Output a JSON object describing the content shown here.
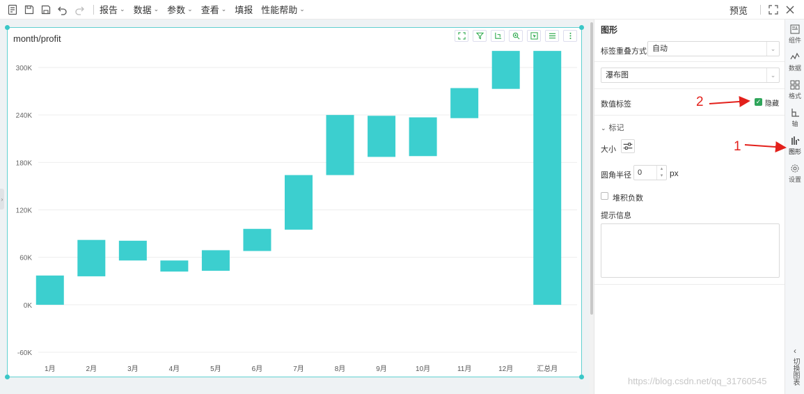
{
  "toolbar": {
    "menus": [
      "报告",
      "数据",
      "参数",
      "查看",
      "填报",
      "性能帮助"
    ],
    "preview_label": "预览"
  },
  "chart": {
    "title": "month/profit"
  },
  "chart_data": {
    "type": "bar",
    "subtype": "waterfall",
    "title": "month/profit",
    "categories": [
      "1月",
      "2月",
      "3月",
      "4月",
      "5月",
      "6月",
      "7月",
      "8月",
      "9月",
      "10月",
      "11月",
      "12月",
      "汇总月"
    ],
    "ranges": [
      [
        0,
        37000
      ],
      [
        36000,
        82000
      ],
      [
        56000,
        81000
      ],
      [
        42000,
        56000
      ],
      [
        43000,
        69000
      ],
      [
        68000,
        96000
      ],
      [
        95000,
        164000
      ],
      [
        164000,
        240000
      ],
      [
        187000,
        239000
      ],
      [
        188000,
        237000
      ],
      [
        236000,
        274000
      ],
      [
        273000,
        321000
      ],
      [
        0,
        321000
      ]
    ],
    "yticks": [
      "300K",
      "240K",
      "180K",
      "120K",
      "60K",
      "0K",
      "-60K"
    ],
    "ylim": [
      -60000,
      300000
    ],
    "color": "#3ccfcf",
    "grid": true
  },
  "panel": {
    "title": "图形",
    "overlap_label": "标签重叠方式",
    "overlap_value": "自动",
    "chart_type_value": "瀑布图",
    "data_label": "数值标签",
    "hide_label": "隐藏",
    "marker_label": "标记",
    "size_label": "大小",
    "radius_label": "圆角半径",
    "radius_value": "0",
    "radius_unit": "px",
    "stack_label": "堆积负数",
    "tooltip_label": "提示信息"
  },
  "sidebar": {
    "items": [
      {
        "label": "组件",
        "icon": "component-icon"
      },
      {
        "label": "数据",
        "icon": "data-icon"
      },
      {
        "label": "格式",
        "icon": "format-icon"
      },
      {
        "label": "轴",
        "icon": "axis-icon"
      },
      {
        "label": "图形",
        "icon": "shape-icon"
      },
      {
        "label": "设置",
        "icon": "settings-icon"
      }
    ],
    "switch_label": "切换图表"
  },
  "annotations": {
    "num1": "1",
    "num2": "2",
    "color": "#e3201b"
  },
  "watermark": "https://blog.csdn.net/qq_31760545"
}
